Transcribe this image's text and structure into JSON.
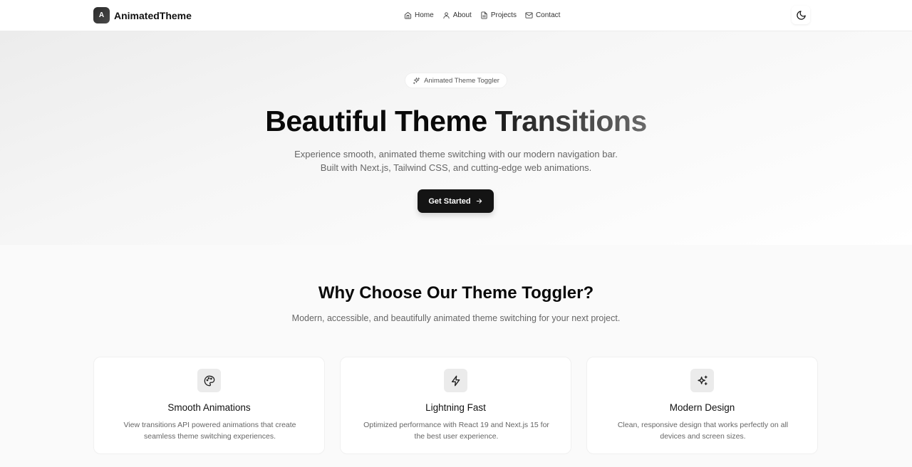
{
  "brand": {
    "mark": "A",
    "name": "AnimatedTheme"
  },
  "nav": [
    {
      "label": "Home",
      "icon": "home-icon"
    },
    {
      "label": "About",
      "icon": "user-icon"
    },
    {
      "label": "Projects",
      "icon": "file-icon"
    },
    {
      "label": "Contact",
      "icon": "mail-icon"
    }
  ],
  "theme_toggle": {
    "icon": "moon-icon"
  },
  "hero": {
    "badge": "Animated Theme Toggler",
    "title_main": "Beautiful Theme ",
    "title_fade": "Transitions",
    "subtitle": "Experience smooth, animated theme switching with our modern navigation bar. Built with Next.js, Tailwind CSS, and cutting-edge web animations.",
    "cta_label": "Get Started"
  },
  "features": {
    "title": "Why Choose Our Theme Toggler?",
    "subtitle": "Modern, accessible, and beautifully animated theme switching for your next project.",
    "cards": [
      {
        "icon": "palette-icon",
        "title": "Smooth Animations",
        "desc": "View transitions API powered animations that create seamless theme switching experiences."
      },
      {
        "icon": "zap-icon",
        "title": "Lightning Fast",
        "desc": "Optimized performance with React 19 and Next.js 15 for the best user experience."
      },
      {
        "icon": "sparkles-icon",
        "title": "Modern Design",
        "desc": "Clean, responsive design that works perfectly on all devices and screen sizes."
      }
    ]
  },
  "colors": {
    "primary": "#141414",
    "muted_text": "#666666",
    "card_icon_bg": "#ebebeb"
  }
}
